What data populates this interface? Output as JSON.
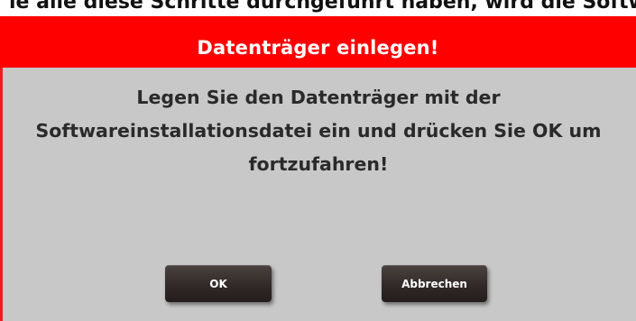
{
  "background_text": "ie alle diese Schritte durchgeführt haben, wird die Software installiert",
  "dialog": {
    "title": "Datenträger einlegen!",
    "message": "Legen Sie den Datenträger mit der Softwareinstallationsdatei ein und drücken Sie OK um fortzufahren!",
    "ok_label": "OK",
    "cancel_label": "Abbrechen"
  },
  "colors": {
    "titlebar": "#fe0000",
    "dialog_bg": "#c8c8c8",
    "button_bg": "#2f2826"
  }
}
